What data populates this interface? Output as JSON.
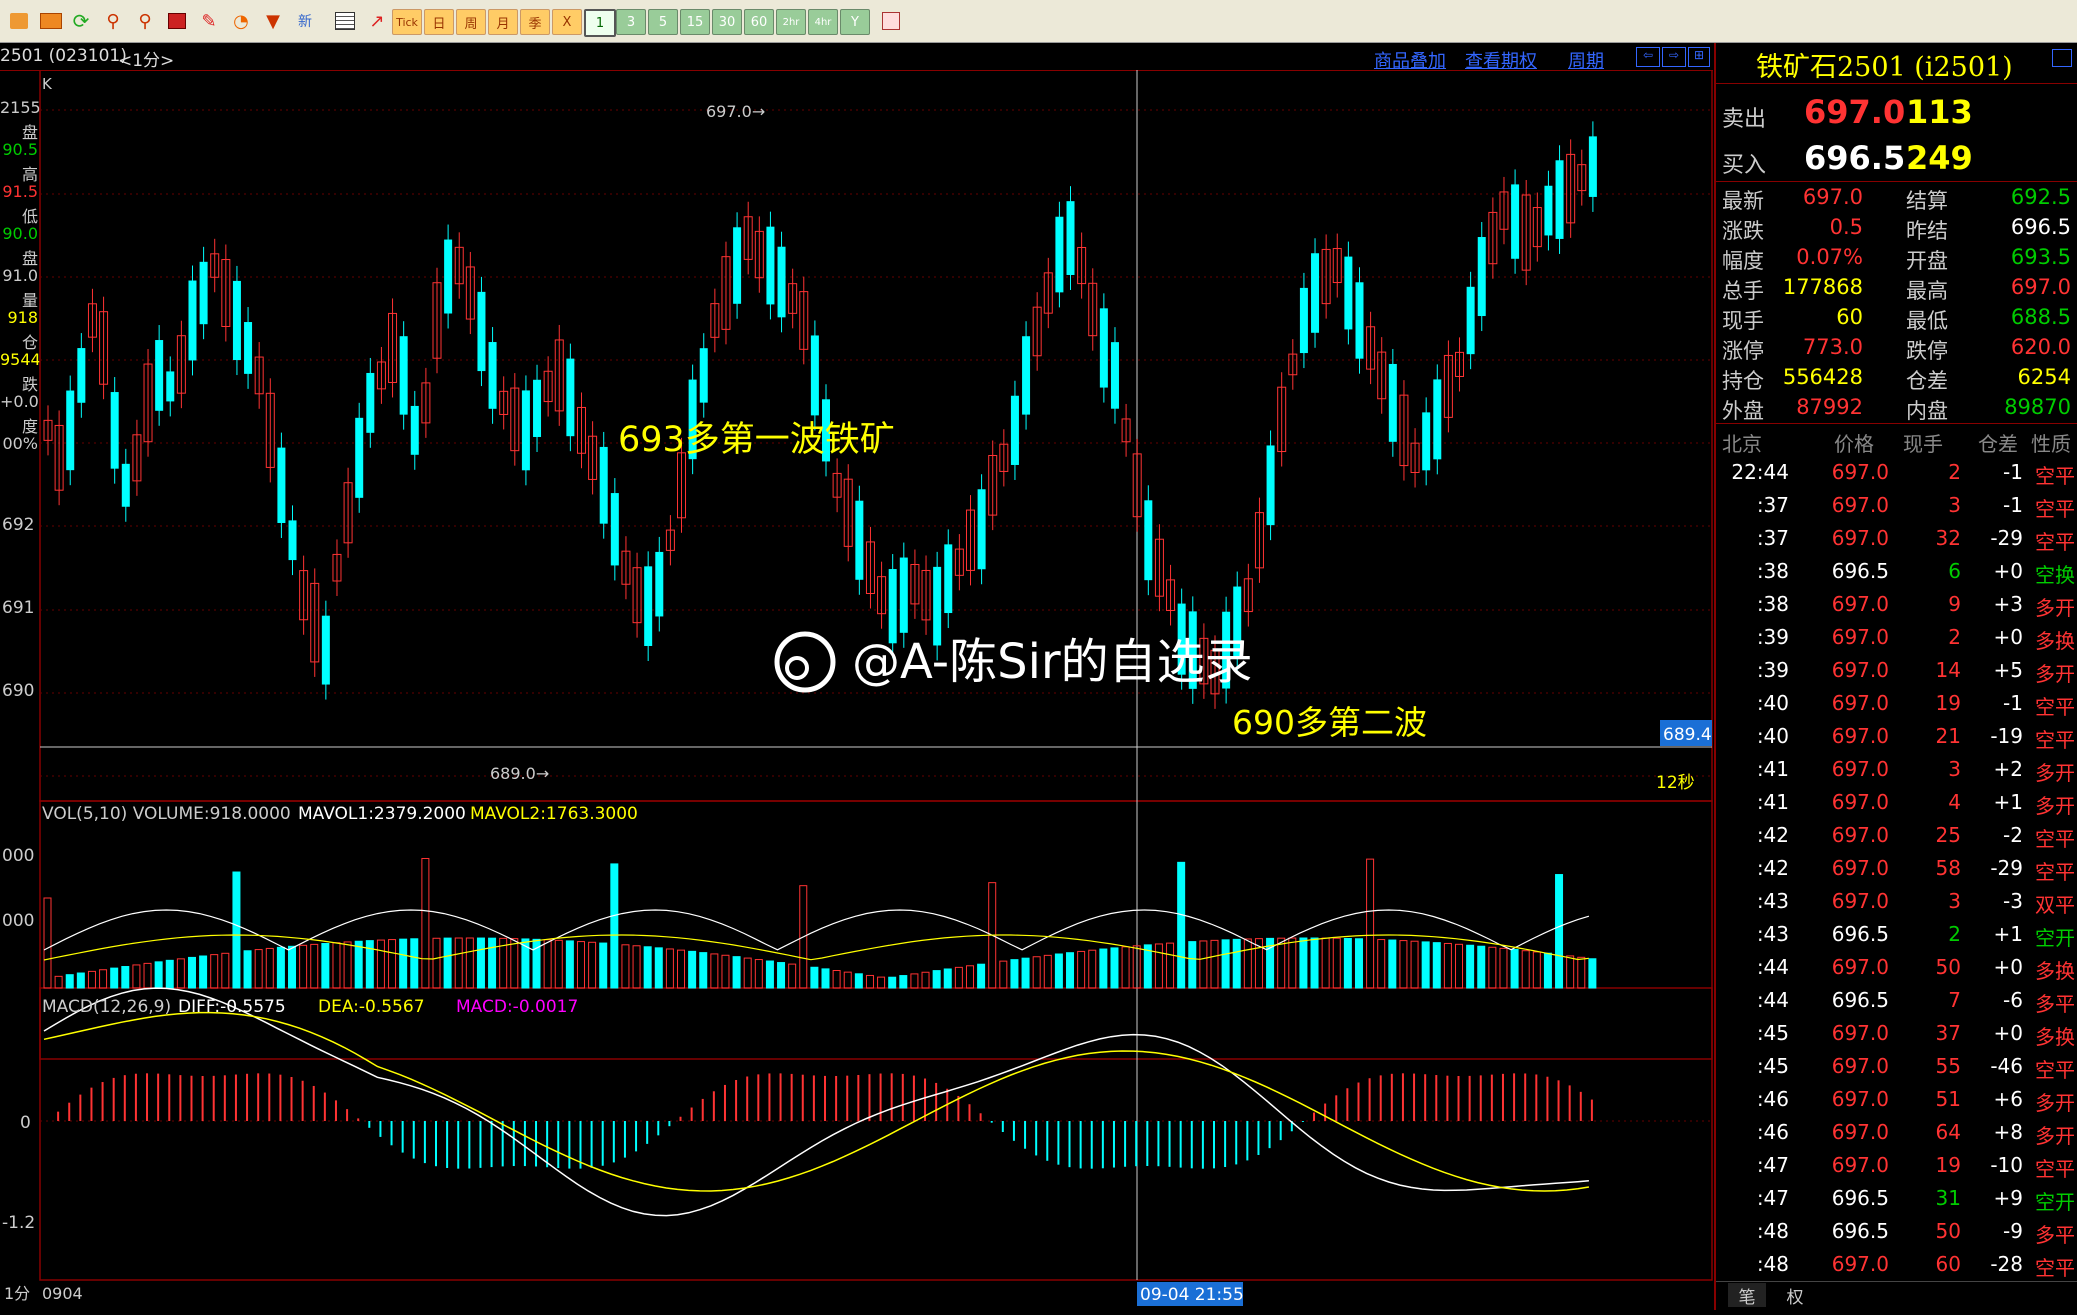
{
  "toolbar": {
    "tick": "Tick",
    "periods": [
      "日",
      "周",
      "月",
      "季",
      "X"
    ],
    "minutes": [
      "1",
      "3",
      "5",
      "15",
      "30",
      "60",
      "2hr",
      "4hr",
      "Y"
    ],
    "icons": [
      "chart-icon",
      "report-icon",
      "refresh-icon",
      "zoom-in-icon",
      "zoom-out-icon",
      "window-icon",
      "pen-icon",
      "pie-icon",
      "funnel-icon",
      "new-icon"
    ]
  },
  "title": {
    "contract": "2501 (023101)",
    "period": "<1分>",
    "links": [
      "商品叠加",
      "查看期权",
      "周期"
    ]
  },
  "left_axis": {
    "labels": [
      "2155",
      "盘",
      "90.5",
      "高",
      "91.5",
      "低",
      "90.0",
      "盘",
      "91.0",
      "量",
      "918",
      "仓",
      "9544",
      "跌",
      "+0.0",
      "度",
      "00%"
    ],
    "k_label": "K"
  },
  "price_chart": {
    "high_marker": "697.0",
    "low_marker": "689.0",
    "y_ticks": [
      "692",
      "691",
      "690"
    ],
    "annotation1": "693多第一波铁矿",
    "annotation2": "690多第二波",
    "watermark": "@A-陈Sir的自选录",
    "crosshair_price": "689.4",
    "countdown": "12秒"
  },
  "volume_chart": {
    "header_vol": "VOL(5,10) VOLUME:918.0000",
    "header_m1": "MAVOL1:2379.2000",
    "header_m2": "MAVOL2:1763.3000",
    "y_ticks": [
      "000",
      "000"
    ]
  },
  "macd_chart": {
    "header_name": "MACD(12,26,9)",
    "header_diff": "DIFF:-0.5575",
    "header_dea": "DEA:-0.5567",
    "header_macd": "MACD:-0.0017",
    "y_ticks": [
      "0",
      "-1.2"
    ]
  },
  "bottom": {
    "period": "1分",
    "date_left": "0904",
    "crosshair_time": "09-04 21:55"
  },
  "quote": {
    "name": "铁矿石2501 (i2501)",
    "sell_label": "卖出",
    "sell_price": "697.0",
    "sell_vol": "113",
    "buy_label": "买入",
    "buy_price": "696.5",
    "buy_vol": "249",
    "stats": [
      {
        "l1": "最新",
        "v1": "697.0",
        "l2": "结算",
        "v2": "692.5"
      },
      {
        "l1": "涨跌",
        "v1": "0.5",
        "l2": "昨结",
        "v2": "696.5"
      },
      {
        "l1": "幅度",
        "v1": "0.07%",
        "l2": "开盘",
        "v2": "693.5"
      },
      {
        "l1": "总手",
        "v1": "177868",
        "l2": "最高",
        "v2": "697.0"
      },
      {
        "l1": "现手",
        "v1": "60",
        "l2": "最低",
        "v2": "688.5"
      },
      {
        "l1": "涨停",
        "v1": "773.0",
        "l2": "跌停",
        "v2": "620.0"
      },
      {
        "l1": "持仓",
        "v1": "556428",
        "l2": "仓差",
        "v2": "6254"
      },
      {
        "l1": "外盘",
        "v1": "87992",
        "l2": "内盘",
        "v2": "89870"
      }
    ],
    "tick_headers": [
      "北京",
      "价格",
      "现手",
      "仓差",
      "性质"
    ],
    "ticks": [
      {
        "t": "22:44",
        "p": "697.0",
        "v": "2",
        "d": "-1",
        "n": "空平"
      },
      {
        "t": ":37",
        "p": "697.0",
        "v": "3",
        "d": "-1",
        "n": "空平"
      },
      {
        "t": ":37",
        "p": "697.0",
        "v": "32",
        "d": "-29",
        "n": "空平"
      },
      {
        "t": ":38",
        "p": "696.5",
        "v": "6",
        "d": "+0",
        "n": "空换"
      },
      {
        "t": ":38",
        "p": "697.0",
        "v": "9",
        "d": "+3",
        "n": "多开"
      },
      {
        "t": ":39",
        "p": "697.0",
        "v": "2",
        "d": "+0",
        "n": "多换"
      },
      {
        "t": ":39",
        "p": "697.0",
        "v": "14",
        "d": "+5",
        "n": "多开"
      },
      {
        "t": ":40",
        "p": "697.0",
        "v": "19",
        "d": "-1",
        "n": "空平"
      },
      {
        "t": ":40",
        "p": "697.0",
        "v": "21",
        "d": "-19",
        "n": "空平"
      },
      {
        "t": ":41",
        "p": "697.0",
        "v": "3",
        "d": "+2",
        "n": "多开"
      },
      {
        "t": ":41",
        "p": "697.0",
        "v": "4",
        "d": "+1",
        "n": "多开"
      },
      {
        "t": ":42",
        "p": "697.0",
        "v": "25",
        "d": "-2",
        "n": "空平"
      },
      {
        "t": ":42",
        "p": "697.0",
        "v": "58",
        "d": "-29",
        "n": "空平"
      },
      {
        "t": ":43",
        "p": "697.0",
        "v": "3",
        "d": "-3",
        "n": "双平"
      },
      {
        "t": ":43",
        "p": "696.5",
        "v": "2",
        "d": "+1",
        "n": "空开"
      },
      {
        "t": ":44",
        "p": "697.0",
        "v": "50",
        "d": "+0",
        "n": "多换"
      },
      {
        "t": ":44",
        "p": "696.5",
        "v": "7",
        "d": "-6",
        "n": "多平"
      },
      {
        "t": ":45",
        "p": "697.0",
        "v": "37",
        "d": "+0",
        "n": "多换"
      },
      {
        "t": ":45",
        "p": "697.0",
        "v": "55",
        "d": "-46",
        "n": "空平"
      },
      {
        "t": ":46",
        "p": "697.0",
        "v": "51",
        "d": "+6",
        "n": "多开"
      },
      {
        "t": ":46",
        "p": "697.0",
        "v": "64",
        "d": "+8",
        "n": "多开"
      },
      {
        "t": ":47",
        "p": "697.0",
        "v": "19",
        "d": "-10",
        "n": "空平"
      },
      {
        "t": ":47",
        "p": "696.5",
        "v": "31",
        "d": "+9",
        "n": "空开"
      },
      {
        "t": ":48",
        "p": "696.5",
        "v": "50",
        "d": "-9",
        "n": "多平"
      },
      {
        "t": ":48",
        "p": "697.0",
        "v": "60",
        "d": "-28",
        "n": "空平"
      }
    ],
    "tabs": [
      "笔",
      "权"
    ]
  },
  "colors": {
    "up": "#ff3333",
    "down": "#00ffff",
    "accent": "#ffff00"
  }
}
